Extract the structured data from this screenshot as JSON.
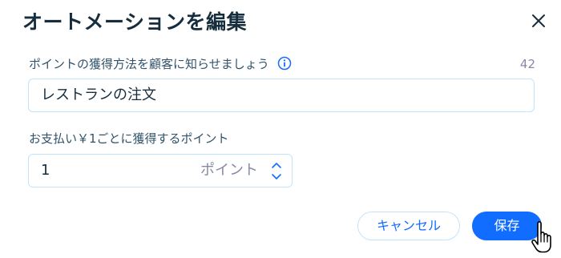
{
  "dialog": {
    "title": "オートメーションを編集",
    "close_icon": "close-icon"
  },
  "message_field": {
    "label": "ポイントの獲得方法を顧客に知らせましょう",
    "info_icon": "info-icon",
    "char_count": "42",
    "value": "レストランの注文"
  },
  "points_field": {
    "label": "お支払い￥1ごとに獲得するポイント",
    "value": "1",
    "suffix": "ポイント",
    "up_icon": "chevron-up-icon",
    "down_icon": "chevron-down-icon"
  },
  "footer": {
    "cancel_label": "キャンセル",
    "save_label": "保存"
  },
  "colors": {
    "accent": "#116dff",
    "title": "#162d3d",
    "label": "#32536a",
    "muted": "#868aa5",
    "border": "#c1e4fe"
  }
}
